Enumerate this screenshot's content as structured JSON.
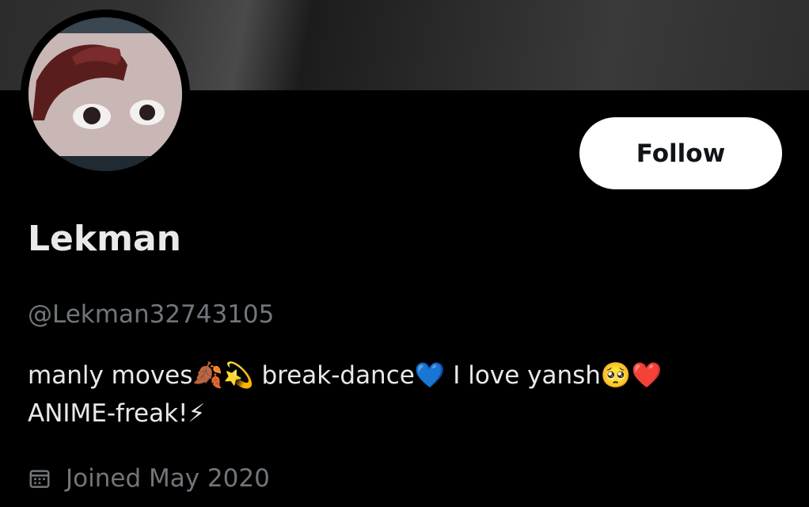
{
  "profile": {
    "display_name": "Lekman",
    "handle": "@Lekman32743105",
    "bio_line1": "manly moves🍂💫 break-dance💙 I love yansh🥺❤️",
    "bio_line2": "ANIME-freak!⚡",
    "joined": "Joined May 2020",
    "follow_label": "Follow"
  },
  "icons": {
    "joined": "calendar-icon"
  },
  "colors": {
    "background": "#000000",
    "primary_text": "#e7e9ea",
    "secondary_text": "#71767b",
    "button_bg": "#ffffff",
    "button_text": "#0f1419"
  }
}
